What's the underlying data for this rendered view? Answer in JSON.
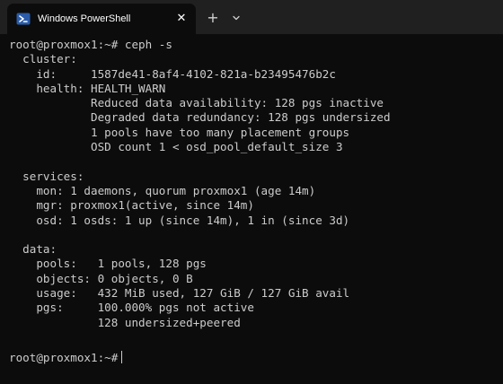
{
  "window": {
    "tab_title": "Windows PowerShell",
    "close_glyph": "✕",
    "new_tab_glyph": "+",
    "dropdown_icon": "chevron-down-icon",
    "shell_icon": "powershell-icon",
    "accent_color": "#2a5caa"
  },
  "terminal": {
    "lines": [
      "root@proxmox1:~# ceph -s",
      "  cluster:",
      "    id:     1587de41-8af4-4102-821a-b23495476b2c",
      "    health: HEALTH_WARN",
      "            Reduced data availability: 128 pgs inactive",
      "            Degraded data redundancy: 128 pgs undersized",
      "            1 pools have too many placement groups",
      "            OSD count 1 < osd_pool_default_size 3",
      "",
      "  services:",
      "    mon: 1 daemons, quorum proxmox1 (age 14m)",
      "    mgr: proxmox1(active, since 14m)",
      "    osd: 1 osds: 1 up (since 14m), 1 in (since 3d)",
      "",
      "  data:",
      "    pools:   1 pools, 128 pgs",
      "    objects: 0 objects, 0 B",
      "    usage:   432 MiB used, 127 GiB / 127 GiB avail",
      "    pgs:     100.000% pgs not active",
      "             128 undersized+peered"
    ],
    "prompt": "root@proxmox1:~#"
  }
}
